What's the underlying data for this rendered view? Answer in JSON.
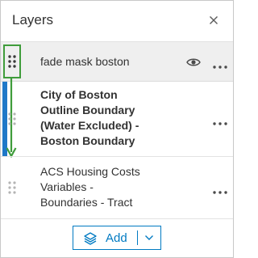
{
  "panel": {
    "title": "Layers",
    "close_icon": "close-icon"
  },
  "layers": [
    {
      "name": "fade mask boston",
      "bold": false,
      "selected": true,
      "icons": [
        "drag-handle-icon",
        "eye-icon",
        "more-options-icon"
      ]
    },
    {
      "name_lines": [
        "City of Boston",
        "Outline Boundary",
        "(Water Excluded) -",
        "Boston Boundary"
      ],
      "bold": true,
      "icons": [
        "drag-handle-icon",
        "more-options-icon"
      ]
    },
    {
      "name_lines": [
        "ACS Housing Costs",
        "Variables -",
        "Boundaries - Tract"
      ],
      "bold": false,
      "icons": [
        "drag-handle-icon",
        "more-options-icon"
      ]
    }
  ],
  "footer": {
    "add_label": "Add",
    "add_icon": "layers-stack-icon",
    "dropdown_icon": "chevron-down-icon"
  },
  "colors": {
    "accent": "#007ac2",
    "highlight_green": "#3f9c3b",
    "drop_indicator_blue": "#1f78c8",
    "selected_bg": "#efefef"
  }
}
